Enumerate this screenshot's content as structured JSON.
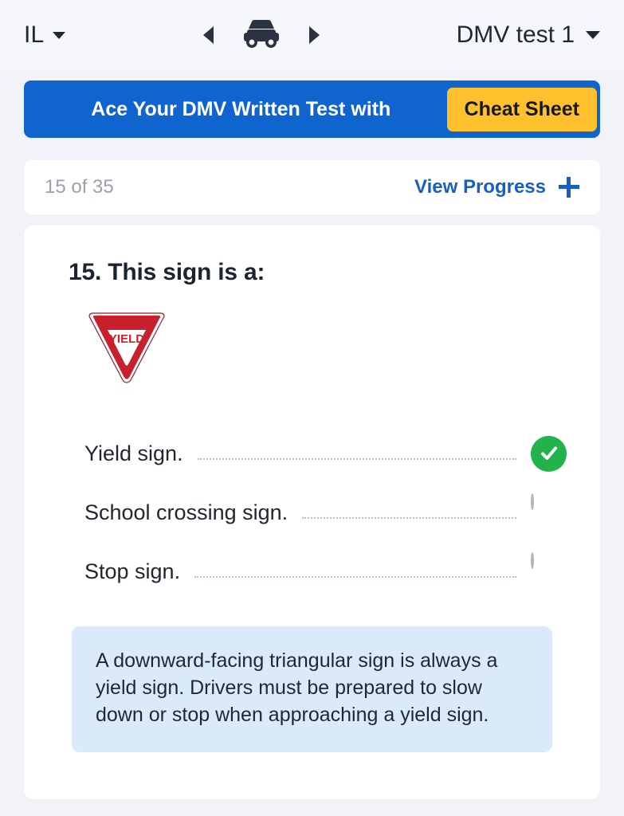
{
  "header": {
    "state_label": "IL",
    "state_caret_icon": "chevron-down-icon",
    "prev_icon": "arrow-left-icon",
    "car_icon": "car-icon",
    "next_icon": "arrow-right-icon",
    "test_label": "DMV test 1",
    "test_caret_icon": "chevron-down-icon"
  },
  "banner": {
    "text": "Ace Your DMV Written Test with",
    "button_label": "Cheat Sheet",
    "bg_color": "#0f64ce",
    "button_color": "#ffc02e"
  },
  "progress": {
    "count_text": "15 of 35",
    "current": 15,
    "total": 35,
    "view_label": "View Progress",
    "plus_icon": "plus-icon",
    "link_color": "#1560c4"
  },
  "question": {
    "number": "15.",
    "title": "15. This sign is a:",
    "image": {
      "name": "yield-sign-image",
      "sign_text": "YIELD",
      "sign_color": "#c8202c",
      "shape": "downward-triangle"
    },
    "answers": [
      {
        "label": "Yield sign.",
        "state": "correct",
        "marker_icon": "check-circle-icon",
        "marker_color": "#24b24c"
      },
      {
        "label": "School crossing sign.",
        "state": "unselected",
        "marker_icon": "radio-empty-icon",
        "marker_color": "#b0b6bf"
      },
      {
        "label": "Stop sign.",
        "state": "unselected",
        "marker_icon": "radio-empty-icon",
        "marker_color": "#b0b6bf"
      }
    ],
    "explanation": "A downward-facing triangular sign is always a yield sign. Drivers must be prepared to slow down or stop when approaching a yield sign.",
    "explanation_bg": "#dbeafb"
  }
}
